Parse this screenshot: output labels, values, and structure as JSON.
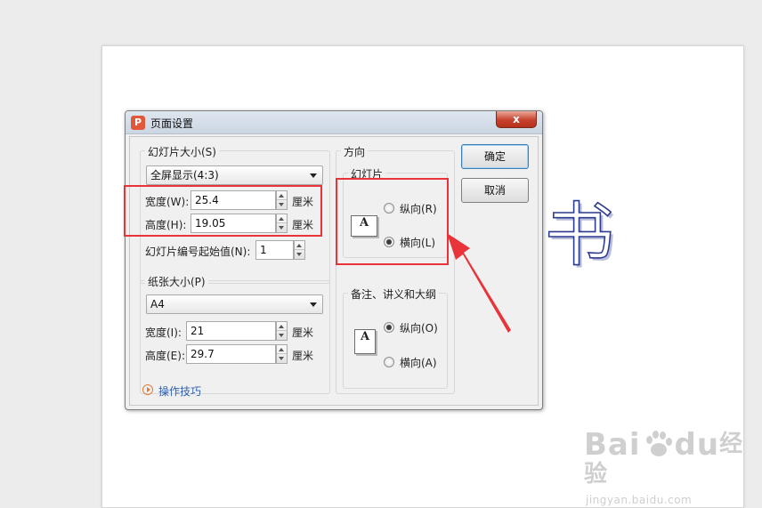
{
  "slide": {
    "text": "书"
  },
  "watermark": {
    "brand": "Bai",
    "brand2": "du",
    "cn": "经验",
    "url": "jingyan.baidu.com"
  },
  "dialog": {
    "app_icon": "P",
    "title": "页面设置",
    "close_label": "x",
    "slide_size": {
      "group_label": "幻灯片大小(S)",
      "selected": "全屏显示(4:3)",
      "width_label": "宽度(W):",
      "width_value": "25.4",
      "height_label": "高度(H):",
      "height_value": "19.05",
      "unit": "厘米",
      "start_label": "幻灯片编号起始值(N):",
      "start_value": "1"
    },
    "paper_size": {
      "group_label": "纸张大小(P)",
      "selected": "A4",
      "width_label": "宽度(I):",
      "width_value": "21",
      "height_label": "高度(E):",
      "height_value": "29.7",
      "unit": "厘米"
    },
    "orientation": {
      "label": "方向",
      "slides": {
        "label": "幻灯片",
        "icon_letter": "A",
        "portrait": "纵向(R)",
        "landscape": "横向(L)",
        "selected": "landscape"
      },
      "notes": {
        "label": "备注、讲义和大纲",
        "icon_letter": "A",
        "portrait": "纵向(O)",
        "landscape": "横向(A)",
        "selected": "portrait"
      }
    },
    "ok_label": "确定",
    "cancel_label": "取消",
    "tips_label": "操作技巧"
  },
  "colors": {
    "highlight": "#e8333a",
    "arrow": "#e8333a",
    "link": "#2e5fae",
    "app_icon": "#e1573a"
  }
}
